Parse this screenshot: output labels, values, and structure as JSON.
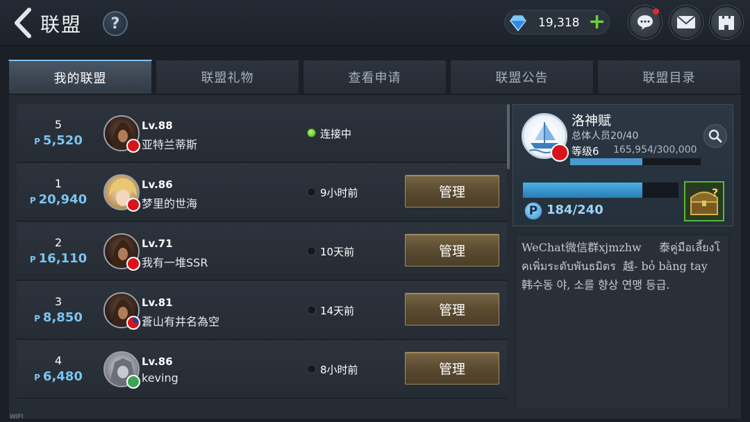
{
  "header": {
    "title": "联盟",
    "help_label": "?",
    "gems": "19,318",
    "gem_add": "+"
  },
  "tabs": [
    {
      "label": "我的联盟",
      "active": true
    },
    {
      "label": "联盟礼物",
      "active": false
    },
    {
      "label": "查看申请",
      "active": false
    },
    {
      "label": "联盟公告",
      "active": false
    },
    {
      "label": "联盟目录",
      "active": false
    }
  ],
  "members": [
    {
      "rank": "5",
      "points": "5,520",
      "level": "Lv.88",
      "name": "亚特兰蒂斯",
      "status": "连接中",
      "online": true,
      "flag": "cn",
      "manage": ""
    },
    {
      "rank": "1",
      "points": "20,940",
      "level": "Lv.86",
      "name": "梦里的世海",
      "status": "9小时前",
      "online": false,
      "flag": "cn",
      "manage": "管理"
    },
    {
      "rank": "2",
      "points": "16,110",
      "level": "Lv.71",
      "name": "我有一堆SSR",
      "status": "10天前",
      "online": false,
      "flag": "cn",
      "manage": "管理"
    },
    {
      "rank": "3",
      "points": "8,850",
      "level": "Lv.81",
      "name": "蒼山有井名為空",
      "status": "14天前",
      "online": false,
      "flag": "tw",
      "manage": "管理"
    },
    {
      "rank": "4",
      "points": "6,480",
      "level": "Lv.86",
      "name": "keving",
      "status": "8小时前",
      "online": false,
      "flag": "green",
      "manage": "管理"
    }
  ],
  "points_symbol": "P",
  "alliance": {
    "name": "洛神赋",
    "members_label": "总体人员20/40",
    "level_label": "等级",
    "level_value": "6",
    "exp_text": "165,954/300,000",
    "exp_fraction": 0.553,
    "points_text": "184/240",
    "points_fraction": 0.767,
    "notice": "WeChat微信群xjmzhw     泰คู่มือเลี้ยงโคเพิ่มระดับพันธมิตร  越- bỏ bằng tay  韩수동 야, 소를 향상 연맹 등급."
  },
  "status_bar": {
    "wifi": "WIFI"
  },
  "colors": {
    "accent_blue": "#7cc4f2",
    "online_green": "#4fb41e",
    "gem_plus_green": "#6fd03a",
    "button_gold": "#776544"
  }
}
